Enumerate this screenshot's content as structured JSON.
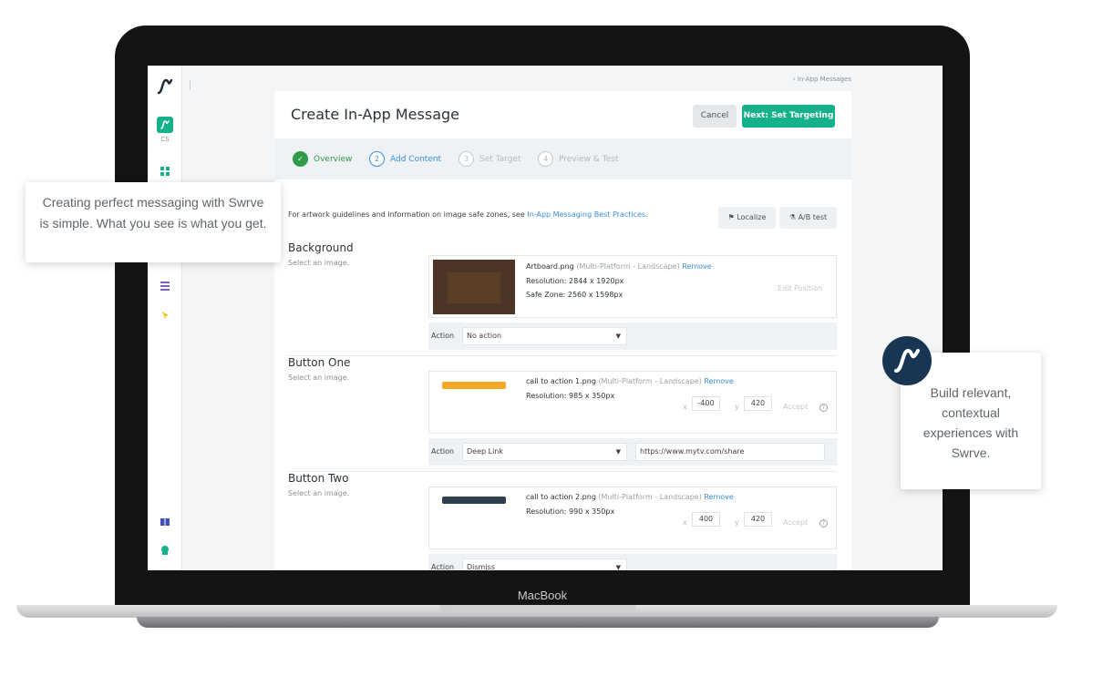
{
  "callouts": {
    "left": "Creating perfect messaging with Swrve is simple. What you see is what you get.",
    "right": "Build relevant, contextual experiences with Swrve."
  },
  "laptop": {
    "label": "MacBook"
  },
  "sidebar": {
    "app_label": "CS"
  },
  "breadcrumb": "‹ In-App Messages",
  "header": {
    "title": "Create In-App Message",
    "cancel": "Cancel",
    "next": "Next: Set Targeting"
  },
  "steps": [
    {
      "number": "✓",
      "label": "Overview",
      "state": "done"
    },
    {
      "number": "2",
      "label": "Add Content",
      "state": "active"
    },
    {
      "number": "3",
      "label": "Set Target",
      "state": "pending"
    },
    {
      "number": "4",
      "label": "Preview & Test",
      "state": "pending"
    }
  ],
  "info": {
    "text": "For artwork guidelines and information on image safe zones, see",
    "link": "In-App Messaging Best Practices."
  },
  "tools": {
    "localize": "Localize",
    "ab_test": "A/B test"
  },
  "sections": {
    "background": {
      "title": "Background",
      "subtitle": "Select an image.",
      "file": "Artboard.png",
      "meta": "(Multi-Platform - Landscape)",
      "remove": "Remove",
      "resolution": "Resolution: 2844 x 1920px",
      "safe_zone": "Safe Zone: 2560 x 1598px",
      "edit_position": "Edit Position",
      "action_label": "Action",
      "action_value": "No action"
    },
    "button_one": {
      "title": "Button One",
      "subtitle": "Select an image.",
      "file": "call to action 1.png",
      "meta": "(Multi-Platform - Landscape)",
      "remove": "Remove",
      "resolution": "Resolution: 985 x 350px",
      "x_label": "x",
      "x_value": "-400",
      "y_label": "y",
      "y_value": "420",
      "accept": "Accept",
      "action_label": "Action",
      "action_value": "Deep Link",
      "url": "https://www.mytv.com/share",
      "thumb_color": "#f5a623"
    },
    "button_two": {
      "title": "Button Two",
      "subtitle": "Select an image.",
      "file": "call to action 2.png",
      "meta": "(Multi-Platform - Landscape)",
      "remove": "Remove",
      "resolution": "Resolution: 990 x 350px",
      "x_label": "x",
      "x_value": "400",
      "y_label": "y",
      "y_value": "420",
      "accept": "Accept",
      "action_label": "Action",
      "action_value": "Dismiss",
      "thumb_color": "#2f3e4d"
    }
  },
  "colors": {
    "accent": "#14b18a",
    "link": "#3a8fd6",
    "brand_dark": "#183653"
  }
}
